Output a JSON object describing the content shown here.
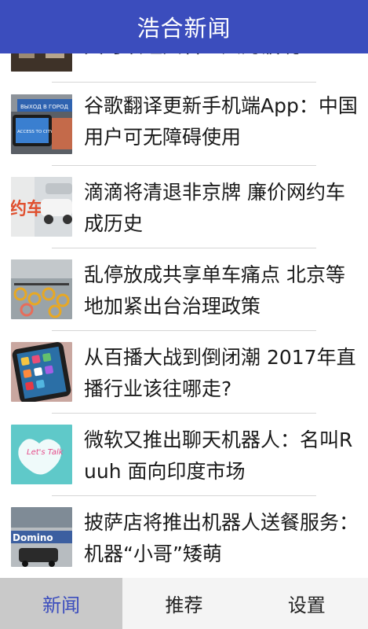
{
  "header": {
    "title": "浩合新闻"
  },
  "news": [
    {
      "title": "大可以砸六名工人的饭碗",
      "thumb_icon": "factory-photo"
    },
    {
      "title": "谷歌翻译更新手机端App：中国用户可无障碍使用",
      "thumb_icon": "translate-sign-photo"
    },
    {
      "title": "滴滴将清退非京牌 廉价网约车成历史",
      "thumb_icon": "didi-car-photo"
    },
    {
      "title": "乱停放成共享单车痛点 北京等地加紧出台治理政策",
      "thumb_icon": "shared-bikes-photo"
    },
    {
      "title": "从百播大战到倒闭潮 2017年直播行业该往哪走?",
      "thumb_icon": "phone-apps-photo"
    },
    {
      "title": "微软又推出聊天机器人：名叫Ruuh 面向印度市场",
      "thumb_icon": "lets-talk-photo"
    },
    {
      "title": "披萨店将推出机器人送餐服务：机器“小哥”矮萌",
      "thumb_icon": "delivery-robot-photo"
    }
  ],
  "tabs": [
    {
      "label": "新闻",
      "active": true
    },
    {
      "label": "推荐",
      "active": false
    },
    {
      "label": "设置",
      "active": false
    }
  ],
  "thumb_texts": {
    "translate": "ВЫХОД В ГОРОД",
    "translate2": "ACCESS TO CITY",
    "didi": "约车",
    "lets_talk": "Let's Talk",
    "domino": "Domino"
  }
}
